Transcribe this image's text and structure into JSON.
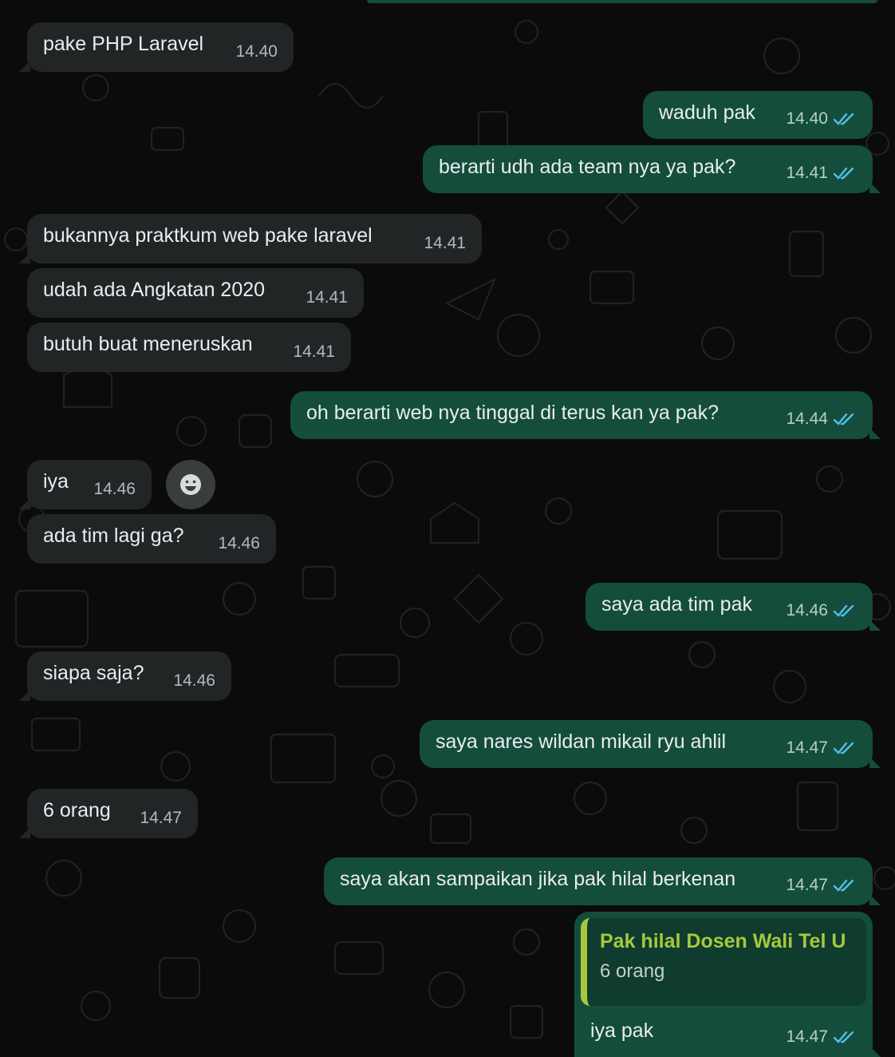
{
  "colors": {
    "background": "#0b0b0b",
    "incoming_bubble": "#222526",
    "outgoing_bubble": "#144d3b",
    "read_ticks": "#53bdeb",
    "quote_accent": "#a7c83c"
  },
  "messages": [
    {
      "id": "m1",
      "direction": "in",
      "text": "pake PHP Laravel",
      "time": "14.40"
    },
    {
      "id": "m2",
      "direction": "out",
      "text": "waduh pak",
      "time": "14.40",
      "status": "read"
    },
    {
      "id": "m3",
      "direction": "out",
      "text": "berarti udh ada team nya ya pak?",
      "time": "14.41",
      "status": "read"
    },
    {
      "id": "m4",
      "direction": "in",
      "text": "bukannya praktkum web pake laravel",
      "time": "14.41"
    },
    {
      "id": "m5",
      "direction": "in",
      "text": "udah ada Angkatan 2020",
      "time": "14.41"
    },
    {
      "id": "m6",
      "direction": "in",
      "text": "butuh buat meneruskan",
      "time": "14.41"
    },
    {
      "id": "m7",
      "direction": "out",
      "text": "oh berarti web nya tinggal di terus kan ya pak?",
      "time": "14.44",
      "status": "read"
    },
    {
      "id": "m8",
      "direction": "in",
      "text": "iya",
      "time": "14.46"
    },
    {
      "id": "m9",
      "direction": "in",
      "text": "ada tim lagi ga?",
      "time": "14.46"
    },
    {
      "id": "m10",
      "direction": "out",
      "text": "saya ada tim pak",
      "time": "14.46",
      "status": "read"
    },
    {
      "id": "m11",
      "direction": "in",
      "text": "siapa saja?",
      "time": "14.46"
    },
    {
      "id": "m12",
      "direction": "out",
      "text": "saya nares wildan mikail ryu ahlil",
      "time": "14.47",
      "status": "read"
    },
    {
      "id": "m13",
      "direction": "in",
      "text": "6 orang",
      "time": "14.47"
    },
    {
      "id": "m14",
      "direction": "out",
      "text": "saya akan sampaikan jika pak hilal berkenan",
      "time": "14.47",
      "status": "read"
    },
    {
      "id": "m15",
      "direction": "out",
      "text": "iya pak",
      "time": "14.47",
      "status": "read",
      "quote": {
        "author": "Pak hilal Dosen Wali Tel U",
        "text": "6 orang"
      }
    }
  ],
  "reaction_button": {
    "icon": "smiley-icon"
  }
}
